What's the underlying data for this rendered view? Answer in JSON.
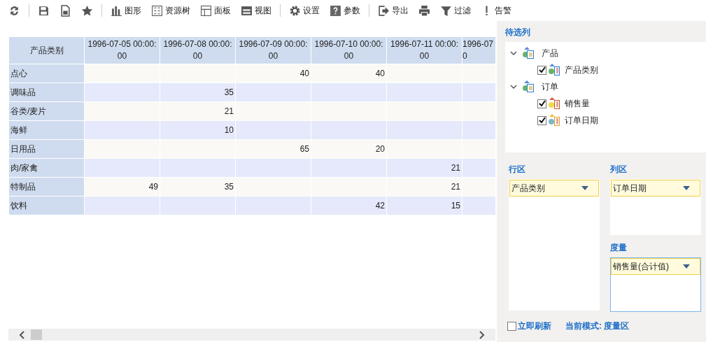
{
  "toolbar": [
    [
      "图形",
      "资源树",
      "面板",
      "视图"
    ],
    [
      "设置",
      "参数"
    ],
    [
      "导出",
      "过滤",
      "告警"
    ]
  ],
  "table": {
    "corner": "产品类别",
    "columns": [
      {
        "lines": [
          "1996-07-05 00:00:",
          "00"
        ]
      },
      {
        "lines": [
          "1996-07-08 00:00:",
          "00"
        ]
      },
      {
        "lines": [
          "1996-07-09 00:00:",
          "00"
        ]
      },
      {
        "lines": [
          "1996-07-10 00:00:",
          "00"
        ]
      },
      {
        "lines": [
          "1996-07-11 00:00:",
          "00"
        ]
      },
      {
        "lines": [
          "1996-07",
          "0"
        ]
      }
    ],
    "rows": [
      {
        "name": "点心",
        "cells": [
          null,
          null,
          "40",
          "40",
          null,
          null
        ]
      },
      {
        "name": "调味品",
        "cells": [
          null,
          "35",
          null,
          null,
          null,
          null
        ]
      },
      {
        "name": "谷类/麦片",
        "cells": [
          null,
          "21",
          null,
          null,
          null,
          null
        ]
      },
      {
        "name": "海鲜",
        "cells": [
          null,
          "10",
          null,
          null,
          null,
          null
        ]
      },
      {
        "name": "日用品",
        "cells": [
          null,
          null,
          "65",
          "20",
          null,
          null
        ]
      },
      {
        "name": "肉/家禽",
        "cells": [
          null,
          null,
          null,
          null,
          "21",
          null
        ]
      },
      {
        "name": "特制品",
        "cells": [
          "49",
          "35",
          null,
          null,
          "21",
          null
        ]
      },
      {
        "name": "饮料",
        "cells": [
          null,
          null,
          null,
          "42",
          "15",
          null
        ]
      }
    ]
  },
  "candidates": {
    "title": "待选列",
    "tree": [
      {
        "label": "产品",
        "expanded": true,
        "children": [
          {
            "label": "产品类别",
            "checked": true,
            "kind": "dimension"
          }
        ]
      },
      {
        "label": "订单",
        "expanded": true,
        "children": [
          {
            "label": "销售量",
            "checked": true,
            "kind": "measure"
          },
          {
            "label": "订单日期",
            "checked": true,
            "kind": "date"
          }
        ]
      }
    ]
  },
  "zones": [
    {
      "title": "行区",
      "active": false,
      "fields": [
        "产品类别"
      ]
    },
    {
      "title": "列区",
      "active": false,
      "fields": [
        "订单日期"
      ]
    },
    {
      "title": "度量",
      "active": true,
      "fields": [
        "销售量(合计值)"
      ]
    }
  ],
  "auto_refresh": {
    "label": "立即刷新",
    "checked": false
  },
  "mode": "当前模式: 度量区"
}
